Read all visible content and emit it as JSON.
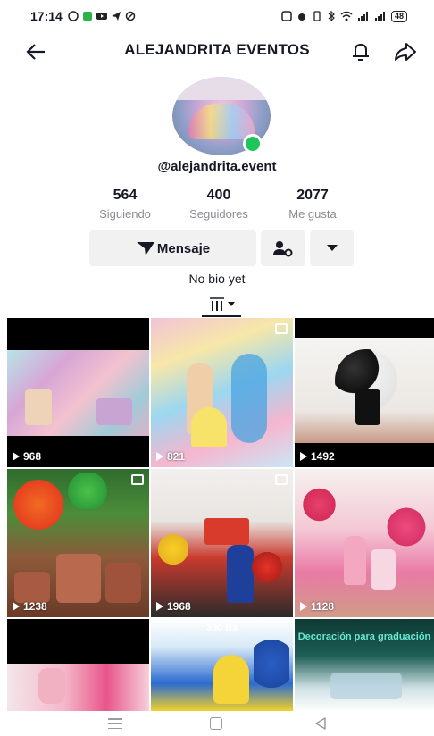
{
  "status_bar": {
    "time": "17:14",
    "battery": "48"
  },
  "header": {
    "title": "ALEJANDRITA EVENTOS"
  },
  "profile": {
    "username": "@alejandrita.event",
    "bio": "No bio yet",
    "online_color": "#20c55a",
    "stats": [
      {
        "value": "564",
        "label": "Siguiendo"
      },
      {
        "value": "400",
        "label": "Seguidores"
      },
      {
        "value": "2077",
        "label": "Me gusta"
      }
    ]
  },
  "actions": {
    "message_label": "Mensaje"
  },
  "grid": {
    "videos": [
      {
        "views": "968"
      },
      {
        "views": "821"
      },
      {
        "views": "1492"
      },
      {
        "views": "1238"
      },
      {
        "views": "1968"
      },
      {
        "views": "1128"
      },
      {
        "views": ""
      },
      {
        "views": "",
        "caption": "380 Bs"
      },
      {
        "views": "",
        "caption": "Decoración para graduación"
      }
    ]
  },
  "colors": {
    "accent": "#161823",
    "button_bg": "#f1f1f2",
    "muted_text": "#8a8b91"
  }
}
